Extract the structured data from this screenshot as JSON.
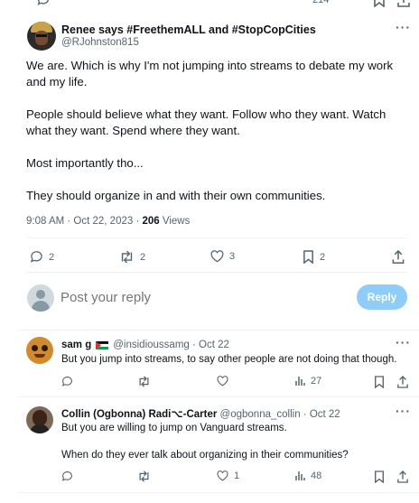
{
  "top_actions": {
    "views_count": "214"
  },
  "main_tweet": {
    "display_name": "Renee says #FreethemALL and #StopCopCities",
    "handle": "@RJohnston815",
    "paragraphs": [
      "We are. Which is why I'm not jumping into streams to debate my work and my life.",
      "People should believe what they want. Follow who they want. Watch what they want. Spend where they want.",
      "Most importantly tho...",
      "They should organize in and with their own communities."
    ],
    "timestamp": "9:08 AM · Oct 22, 2023 · ",
    "views_number": "206",
    "views_label": " Views",
    "actions": {
      "replies": "2",
      "retweets": "2",
      "likes": "3",
      "bookmarks": "2"
    }
  },
  "reply_box": {
    "placeholder": "Post your reply",
    "button_label": "Reply"
  },
  "replies": [
    {
      "display_name": "sam g",
      "handle": "@insidioussamg",
      "dot": " · ",
      "date": "Oct 22",
      "text": "But you jump into streams, to say other people are not doing that though.",
      "views": "27"
    },
    {
      "display_name": "Collin (Ogbonna) Radi⌥-Carter",
      "handle": "@ogbonna_collin",
      "dot": " · ",
      "date": "Oct 22",
      "text1": "But you are willing to jump on Vanguard streams.",
      "text2": "When do they ever talk about organizing in their communities?",
      "likes": "1",
      "views": "48"
    }
  ],
  "colors": {
    "accent": "#1d9bf0",
    "reply_button_disabled": "#8ecdf8",
    "muted": "#536471",
    "divider": "#eff3f4"
  }
}
